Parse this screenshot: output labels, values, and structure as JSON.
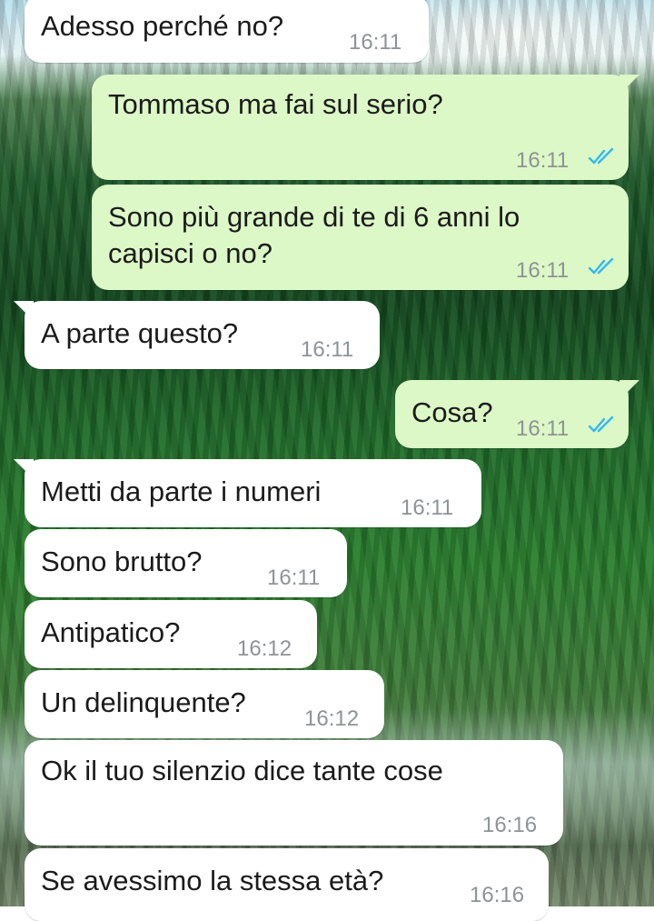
{
  "chat": {
    "messages": [
      {
        "direction": "incoming",
        "text": "Adesso perché no?",
        "time": "16:11"
      },
      {
        "direction": "outgoing",
        "text": "Tommaso ma fai sul serio?",
        "time": "16:11",
        "status": "read-double-check-icon"
      },
      {
        "direction": "outgoing",
        "text_line1": "Sono più grande di te di 6 anni lo",
        "text_line2": "capisci o no?",
        "time": "16:11",
        "status": "read-double-check-icon"
      },
      {
        "direction": "incoming",
        "text": "A parte questo?",
        "time": "16:11"
      },
      {
        "direction": "outgoing",
        "text": "Cosa?",
        "time": "16:11",
        "status": "read-double-check-icon"
      },
      {
        "direction": "incoming",
        "text": "Metti da parte i numeri",
        "time": "16:11"
      },
      {
        "direction": "incoming",
        "text": "Sono brutto?",
        "time": "16:11"
      },
      {
        "direction": "incoming",
        "text": "Antipatico?",
        "time": "16:12"
      },
      {
        "direction": "incoming",
        "text": "Un delinquente?",
        "time": "16:12"
      },
      {
        "direction": "incoming",
        "text": "Ok il tuo silenzio dice tante cose",
        "time": "16:16"
      },
      {
        "direction": "incoming",
        "text": "Se avessimo la stessa età?",
        "time": "16:16"
      }
    ]
  },
  "colors": {
    "incoming_bubble": "#ffffff",
    "outgoing_bubble": "#dcf8c6",
    "timestamp": "#8f9396",
    "read_check": "#34b7f1",
    "text": "#1b1b1b"
  }
}
